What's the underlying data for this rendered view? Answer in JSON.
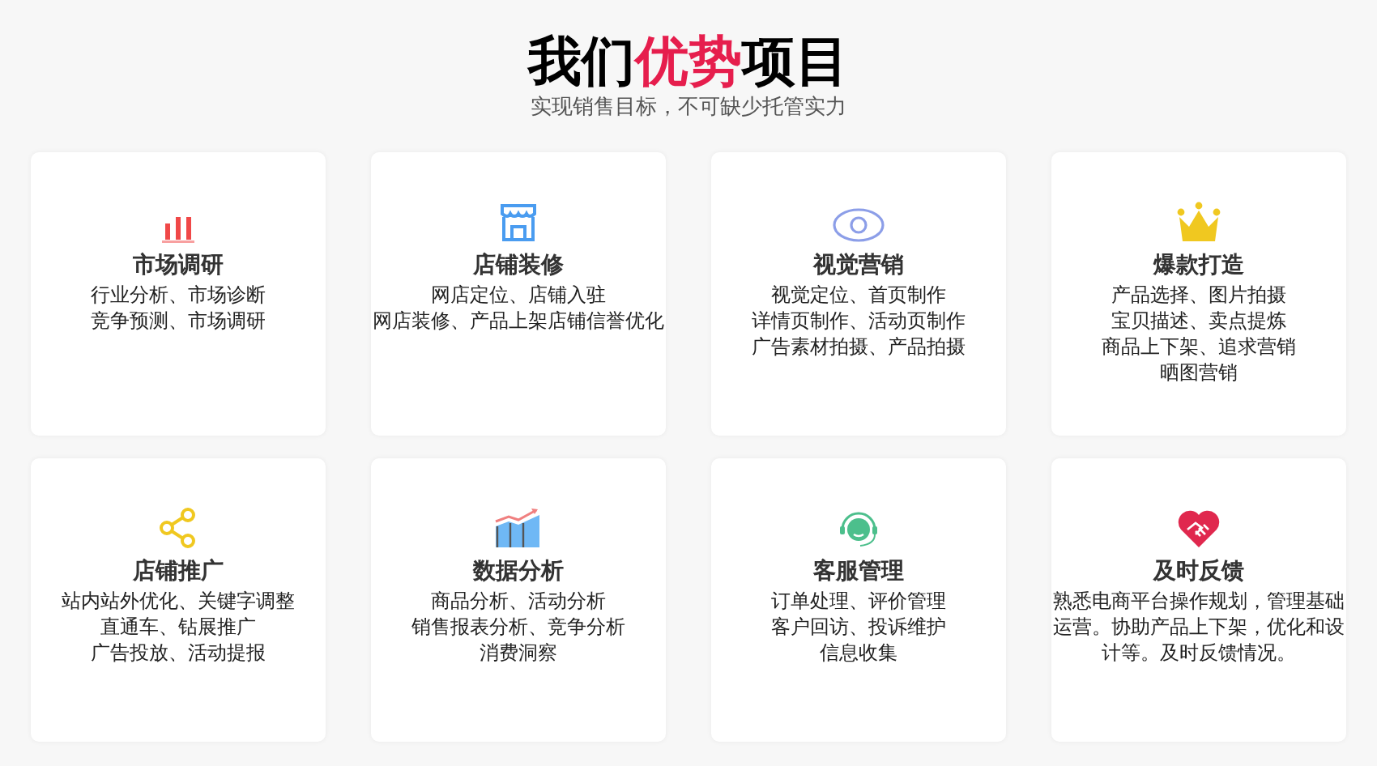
{
  "heading": {
    "before": "我们",
    "highlight": "优势",
    "after": "项目"
  },
  "subtitle": "实现销售目标，不可缺少托管实力",
  "cards": [
    {
      "title": "市场调研",
      "lines": [
        "行业分析、市场诊断",
        "竞争预测、市场调研"
      ]
    },
    {
      "title": "店铺装修",
      "lines": [
        "网店定位、店铺入驻",
        "网店装修、产品上架店铺信誉优化"
      ]
    },
    {
      "title": "视觉营销",
      "lines": [
        "视觉定位、首页制作",
        "详情页制作、活动页制作",
        "广告素材拍摄、产品拍摄"
      ]
    },
    {
      "title": "爆款打造",
      "lines": [
        "产品选择、图片拍摄",
        "宝贝描述、卖点提炼",
        "商品上下架、追求营销",
        "晒图营销"
      ]
    },
    {
      "title": "店铺推广",
      "lines": [
        "站内站外优化、关键字调整",
        "直通车、钻展推广",
        "广告投放、活动提报"
      ]
    },
    {
      "title": "数据分析",
      "lines": [
        "商品分析、活动分析",
        "销售报表分析、竞争分析",
        "消费洞察"
      ]
    },
    {
      "title": "客服管理",
      "lines": [
        "订单处理、评价管理",
        "客户回访、投诉维护",
        "信息收集"
      ]
    },
    {
      "title": "及时反馈",
      "lines": [
        "熟悉电商平台操作规划，管理基础运营。协助产品上下架，优化和设计等。及时反馈情况。"
      ]
    }
  ]
}
